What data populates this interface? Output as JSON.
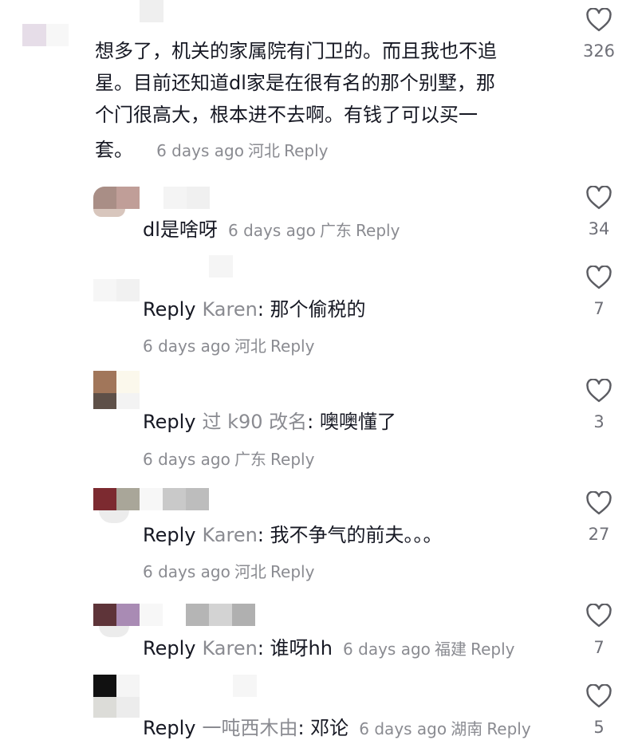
{
  "comments": [
    {
      "lines": [
        "想多了，机关的家属院有门卫的。而且我也不追",
        "星。目前还知道dl家是在很有名的那个别墅，那",
        "个门很高大，根本进不去啊。有钱了可以买一",
        "套。"
      ],
      "time": "6 days ago",
      "location": "河北",
      "reply": "Reply",
      "likes": "326"
    },
    {
      "text": "dl是啥呀",
      "time": "6 days ago",
      "location": "广东",
      "reply": "Reply",
      "likes": "34"
    },
    {
      "prefix": "Reply",
      "to": "Karen",
      "text": ": 那个偷税的",
      "time": "6 days ago",
      "location": "河北",
      "reply": "Reply",
      "likes": "7"
    },
    {
      "prefix": "Reply",
      "to": "过 k90 改名",
      "text": ": 噢噢懂了",
      "time": "6 days ago",
      "location": "广东",
      "reply": "Reply",
      "likes": "3"
    },
    {
      "prefix": "Reply",
      "to": "Karen",
      "text": ": 我不争气的前夫。。。",
      "time": "6 days ago",
      "location": "河北",
      "reply": "Reply",
      "likes": "27"
    },
    {
      "prefix": "Reply",
      "to": "Karen",
      "text": ": 谁呀hh",
      "time": "6 days ago",
      "location": "福建",
      "reply": "Reply",
      "likes": "7"
    },
    {
      "prefix": "Reply",
      "to": "一吨西木由",
      "text": ": 邓论",
      "time": "6 days ago",
      "location": "湖南",
      "reply": "Reply",
      "likes": "5"
    }
  ],
  "icons": {
    "like": "heart-outline-icon"
  },
  "colors": {
    "text": "#161823",
    "muted": "#8a8b91"
  }
}
